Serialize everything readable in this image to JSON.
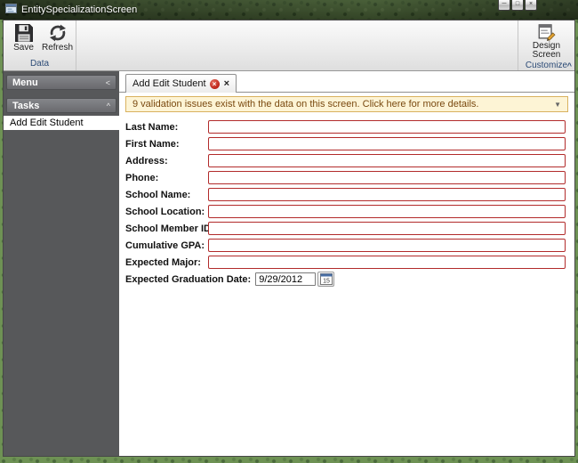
{
  "window": {
    "title": "EntitySpecializationScreen",
    "minimize_glyph": "─",
    "maximize_glyph": "□",
    "close_glyph": "×"
  },
  "ribbon": {
    "save_label": "Save",
    "refresh_label": "Refresh",
    "data_group_label": "Data",
    "design_screen_label": "Design Screen",
    "customize_group_label": "Customize",
    "collapse_glyph": "^"
  },
  "sidebar": {
    "menu_label": "Menu",
    "menu_glyph": "<",
    "tasks_label": "Tasks",
    "tasks_glyph": "^",
    "task_item": "Add Edit Student"
  },
  "tab": {
    "label": "Add Edit Student",
    "error_glyph": "×",
    "close_glyph": "×"
  },
  "banner": {
    "text": "9 validation issues exist with the data on this screen. Click here for more details.",
    "dropdown_glyph": "▼"
  },
  "form": {
    "fields": [
      {
        "label": "Last Name:"
      },
      {
        "label": "First Name:"
      },
      {
        "label": "Address:"
      },
      {
        "label": "Phone:"
      },
      {
        "label": "School Name:"
      },
      {
        "label": "School Location:"
      },
      {
        "label": "School Member ID:"
      },
      {
        "label": "Cumulative GPA:"
      },
      {
        "label": "Expected Major:"
      }
    ],
    "date_label": "Expected Graduation Date:",
    "date_value": "9/29/2012",
    "calendar_day": "15"
  },
  "colors": {
    "invalid_border": "#b22b2b",
    "banner_bg": "#fdf4d5",
    "banner_border": "#d9b25f",
    "banner_text": "#7a4a10",
    "sidebar_bg": "#57585a",
    "group_label_blue": "#2b4a76",
    "error_red": "#bb1f14"
  }
}
